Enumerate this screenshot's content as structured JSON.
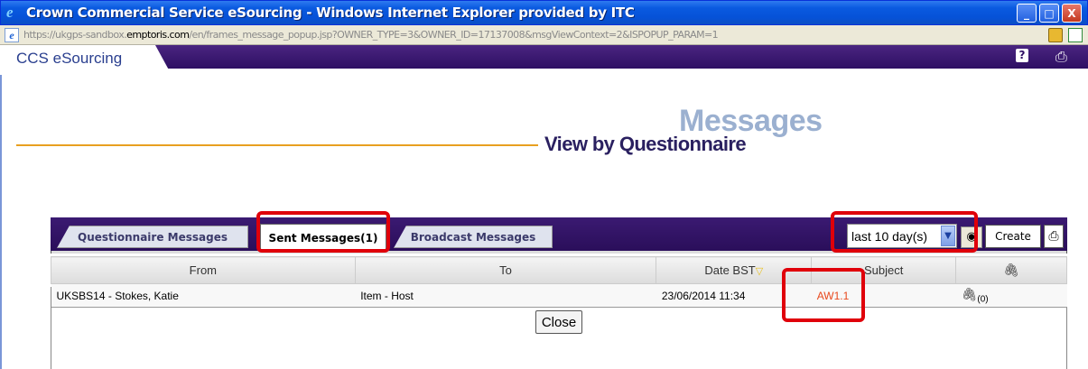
{
  "window": {
    "title": "Crown Commercial Service eSourcing - Windows Internet Explorer provided by ITC",
    "buttons": [
      "_",
      "□",
      "X"
    ]
  },
  "address": {
    "url_prefix": "https://ukgps-sandbox.",
    "url_domain": "emptoris.com",
    "url_suffix": "/en/frames_message_popup.jsp?OWNER_TYPE=3&OWNER_ID=17137008&msgViewContext=2&ISPOPUP_PARAM=1"
  },
  "app": {
    "brand": "CCS eSourcing"
  },
  "heading": {
    "ghost": "Messages",
    "main": "View by Questionnaire"
  },
  "tabs": [
    {
      "label": "Questionnaire Messages",
      "active": false
    },
    {
      "label": "Sent Messages(1)",
      "active": true
    },
    {
      "label": "Broadcast Messages",
      "active": false
    }
  ],
  "toolbar": {
    "period": "last 10 day(s)",
    "create_label": "Create"
  },
  "table": {
    "columns": [
      "From",
      "To",
      "Date BST",
      "Subject",
      ""
    ],
    "rows": [
      {
        "from": "UKSBS14 - Stokes, Katie",
        "to": "Item - Host",
        "date": "23/06/2014 11:34",
        "subject": "AW1.1",
        "attachments": "(0)"
      }
    ]
  },
  "close_label": "Close",
  "colors": {
    "title_bar": "#0a5ae0",
    "header_band": "#2e0f63",
    "accent_line": "#e8a020",
    "highlight": "#e0000a",
    "subject_link": "#e8481c"
  },
  "icons": [
    "ie-logo-icon",
    "minimize-icon",
    "maximize-icon",
    "close-icon",
    "lock-icon",
    "certificate-icon",
    "help-icon",
    "print-icon",
    "binoculars-icon",
    "paperclip-icon",
    "sort-down-icon"
  ]
}
